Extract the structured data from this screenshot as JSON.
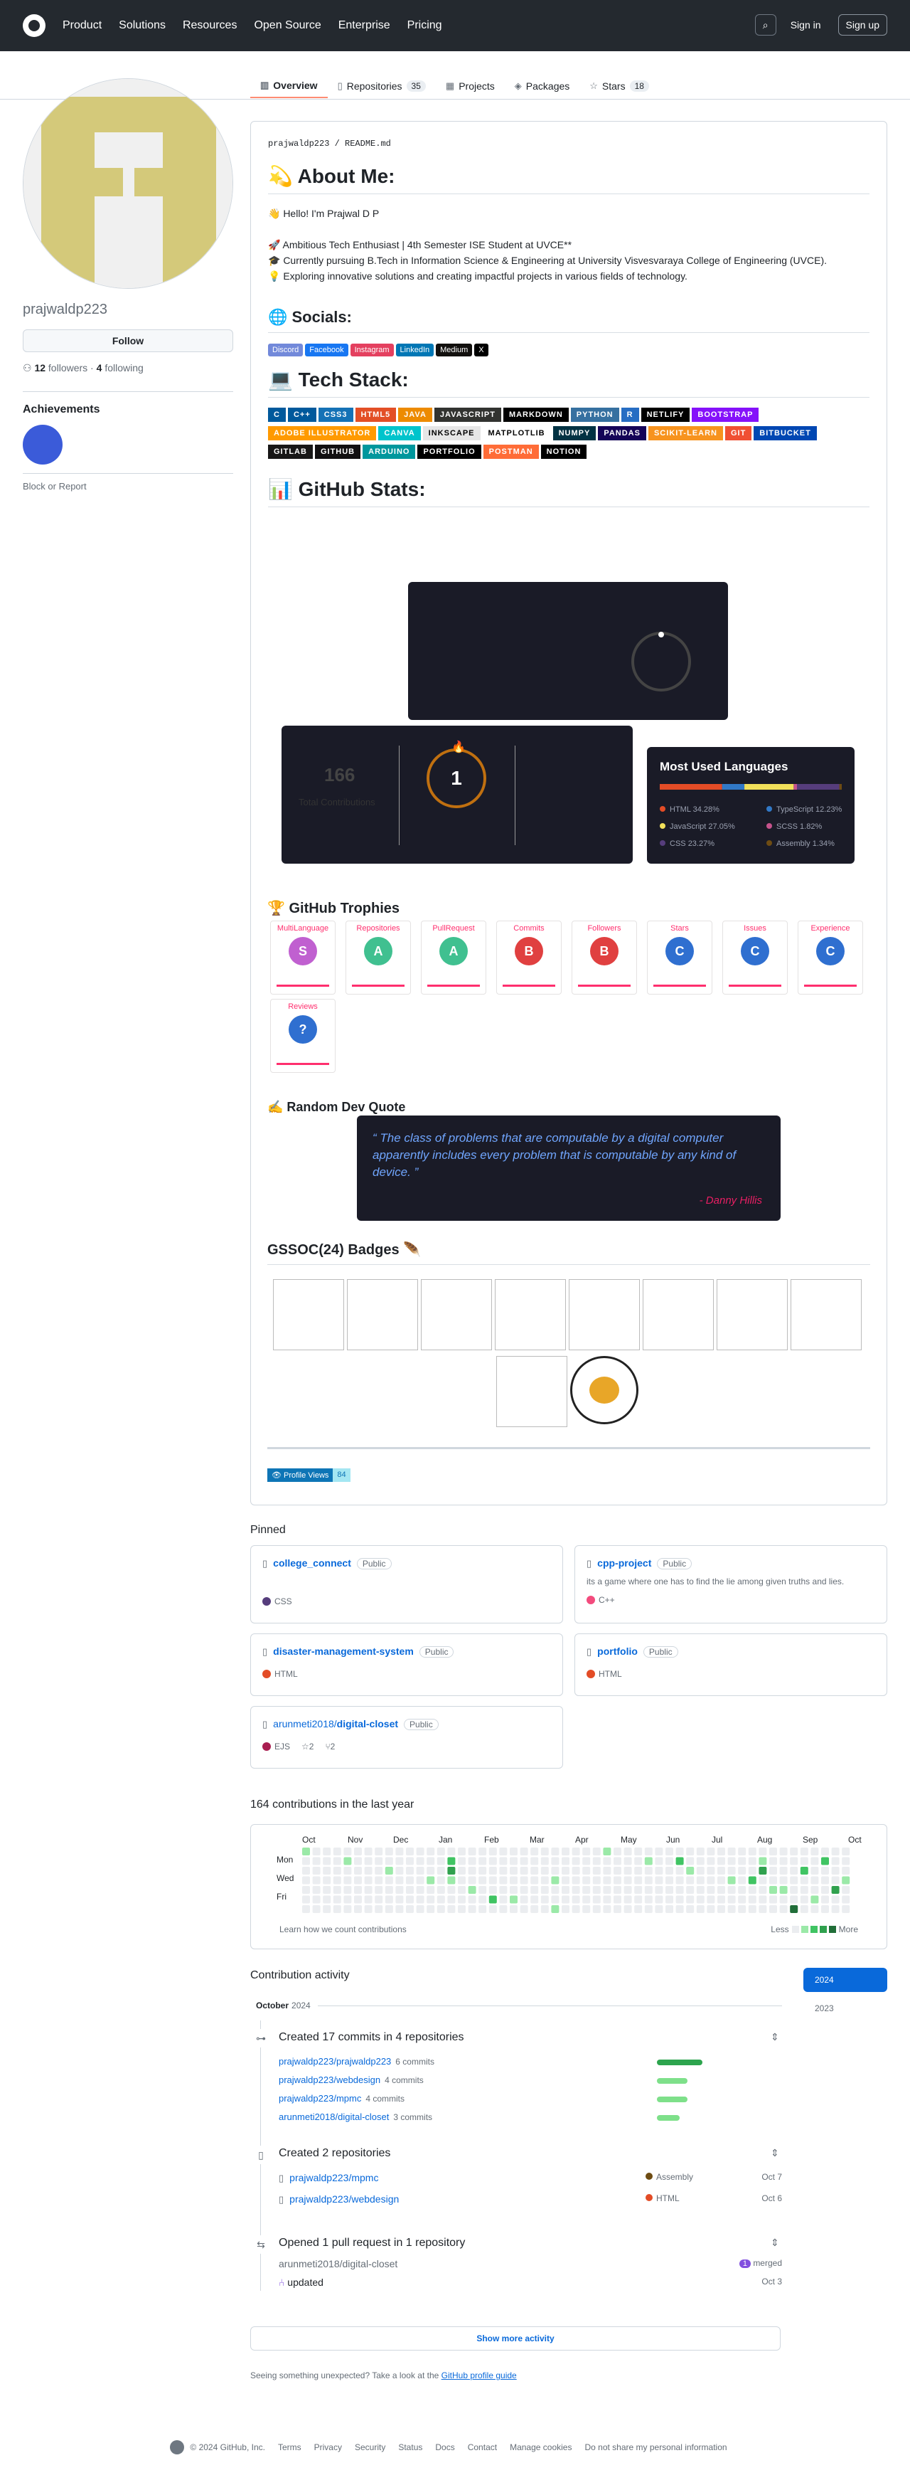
{
  "header": {
    "nav": [
      "Product",
      "Solutions",
      "Resources",
      "Open Source",
      "Enterprise",
      "Pricing"
    ],
    "sign_in": "Sign in",
    "sign_up": "Sign up"
  },
  "tabs": [
    {
      "label": "Overview"
    },
    {
      "label": "Repositories",
      "count": "35"
    },
    {
      "label": "Projects"
    },
    {
      "label": "Packages"
    },
    {
      "label": "Stars",
      "count": "18"
    }
  ],
  "profile": {
    "username": "prajwaldp223",
    "follow": "Follow",
    "followers": "12",
    "followers_label": "followers",
    "following": "4",
    "following_label": "following",
    "achievements_title": "Achievements",
    "report": "Block or Report"
  },
  "readme": {
    "path_user": "prajwaldp223",
    "path_file": "README.md",
    "about_title": "💫 About Me:",
    "about_lines": [
      "👋 Hello! I'm Prajwal D P",
      "🚀 Ambitious Tech Enthusiast | 4th Semester ISE Student at UVCE**",
      "🎓 Currently pursuing B.Tech in Information Science & Engineering at University Visvesvaraya College of Engineering (UVCE).",
      "💡 Exploring innovative solutions and creating impactful projects in various fields of technology."
    ],
    "socials_title": "🌐 Socials:",
    "socials": [
      {
        "label": "Discord",
        "color": "#7289da"
      },
      {
        "label": "Facebook",
        "color": "#1877f2"
      },
      {
        "label": "Instagram",
        "color": "#e4405f"
      },
      {
        "label": "LinkedIn",
        "color": "#0077b5"
      },
      {
        "label": "Medium",
        "color": "#12100e"
      },
      {
        "label": "X",
        "color": "#000000"
      }
    ],
    "tech_title": "💻 Tech Stack:",
    "tech": [
      {
        "label": "C",
        "color": "#00599c"
      },
      {
        "label": "C++",
        "color": "#00599c"
      },
      {
        "label": "CSS3",
        "color": "#1572b6"
      },
      {
        "label": "HTML5",
        "color": "#e34f26"
      },
      {
        "label": "JAVA",
        "color": "#ed8b00"
      },
      {
        "label": "JAVASCRIPT",
        "color": "#323330"
      },
      {
        "label": "MARKDOWN",
        "color": "#000000"
      },
      {
        "label": "PYTHON",
        "color": "#3670a0"
      },
      {
        "label": "R",
        "color": "#276dc3"
      },
      {
        "label": "NETLIFY",
        "color": "#000000"
      },
      {
        "label": "BOOTSTRAP",
        "color": "#8511fa"
      },
      {
        "label": "ADOBE ILLUSTRATOR",
        "color": "#ff9a00"
      },
      {
        "label": "CANVA",
        "color": "#00c4cc"
      },
      {
        "label": "INKSCAPE",
        "color": "#e6e6e6",
        "fg": "#000000"
      },
      {
        "label": "MATPLOTLIB",
        "color": "#ffffff",
        "fg": "#000000"
      },
      {
        "label": "NUMPY",
        "color": "#013243"
      },
      {
        "label": "PANDAS",
        "color": "#150458"
      },
      {
        "label": "SCIKIT-LEARN",
        "color": "#f7931e"
      },
      {
        "label": "GIT",
        "color": "#f05033"
      },
      {
        "label": "BITBUCKET",
        "color": "#0047b3"
      },
      {
        "label": "GITLAB",
        "color": "#181717"
      },
      {
        "label": "GITHUB",
        "color": "#121011"
      },
      {
        "label": "ARDUINO",
        "color": "#00979d"
      },
      {
        "label": "PORTFOLIO",
        "color": "#000000"
      },
      {
        "label": "POSTMAN",
        "color": "#ff6c37"
      },
      {
        "label": "NOTION",
        "color": "#000000"
      }
    ],
    "stats_title": "📊 GitHub Stats:",
    "streak": {
      "total": "166",
      "total_label": "Total Contributions",
      "current": "1"
    },
    "languages": {
      "title": "Most Used Languages",
      "items": [
        {
          "name": "HTML",
          "pct": "34.28%",
          "value": 34.28,
          "color": "#e34c26"
        },
        {
          "name": "TypeScript",
          "pct": "12.23%",
          "value": 12.23,
          "color": "#3178c6"
        },
        {
          "name": "JavaScript",
          "pct": "27.05%",
          "value": 27.05,
          "color": "#f1e05a"
        },
        {
          "name": "SCSS",
          "pct": "1.82%",
          "value": 1.82,
          "color": "#c6538c"
        },
        {
          "name": "CSS",
          "pct": "23.27%",
          "value": 23.27,
          "color": "#563d7c"
        },
        {
          "name": "Assembly",
          "pct": "1.34%",
          "value": 1.34,
          "color": "#6e4c13"
        }
      ]
    },
    "trophies_title": "🏆 GitHub Trophies",
    "trophies": [
      {
        "label": "MultiLanguage",
        "rank": "S",
        "color": "#c060d0"
      },
      {
        "label": "Repositories",
        "rank": "A",
        "color": "#40c090"
      },
      {
        "label": "PullRequest",
        "rank": "A",
        "color": "#40c090"
      },
      {
        "label": "Commits",
        "rank": "B",
        "color": "#e04040"
      },
      {
        "label": "Followers",
        "rank": "B",
        "color": "#e04040"
      },
      {
        "label": "Stars",
        "rank": "C",
        "color": "#2f6fd0"
      },
      {
        "label": "Issues",
        "rank": "C",
        "color": "#2f6fd0"
      },
      {
        "label": "Experience",
        "rank": "C",
        "color": "#2f6fd0"
      },
      {
        "label": "Reviews",
        "rank": "?",
        "color": "#2f6fd0"
      }
    ],
    "quote_title": "✍️ Random Dev Quote",
    "quote": {
      "text": "The class of problems that are computable by a digital computer apparently includes every problem that is computable by any kind of device.",
      "author": "- Danny Hillis"
    },
    "gssoc_title": "GSSOC(24) Badges 🪶",
    "views_label": "Profile Views",
    "views": "84"
  },
  "pinned": {
    "title": "Pinned",
    "items": [
      {
        "name": "college_connect",
        "vis": "Public",
        "desc": "",
        "lang": "CSS",
        "lang_color": "#563d7c"
      },
      {
        "name": "cpp-project",
        "vis": "Public",
        "desc": "its a game where one has to find the lie among given truths and lies.",
        "lang": "C++",
        "lang_color": "#f34b7d"
      },
      {
        "name": "disaster-management-system",
        "vis": "Public",
        "desc": "",
        "lang": "HTML",
        "lang_color": "#e34c26"
      },
      {
        "name": "portfolio",
        "vis": "Public",
        "desc": "",
        "lang": "HTML",
        "lang_color": "#e34c26"
      },
      {
        "owner": "arunmeti2018/",
        "name": "digital-closet",
        "vis": "Public",
        "desc": "",
        "lang": "EJS",
        "lang_color": "#a91e50",
        "stars": "2",
        "forks": "2"
      }
    ]
  },
  "contributions": {
    "title": "164 contributions in the last year",
    "months": [
      "Oct",
      "Nov",
      "Dec",
      "Jan",
      "Feb",
      "Mar",
      "Apr",
      "May",
      "Jun",
      "Jul",
      "Aug",
      "Sep",
      "Oct"
    ],
    "days": [
      "Mon",
      "Wed",
      "Fri"
    ],
    "learn": "Learn how we count contributions",
    "less": "Less",
    "more": "More"
  },
  "activity": {
    "title": "Contribution activity",
    "years": [
      "2024",
      "2023"
    ],
    "month": "October",
    "month_year": "2024",
    "commits": {
      "title": "Created 17 commits in 4 repositories",
      "rows": [
        {
          "repo": "prajwaldp223/prajwaldp223",
          "count": "6 commits",
          "value": 6
        },
        {
          "repo": "prajwaldp223/webdesign",
          "count": "4 commits",
          "value": 4
        },
        {
          "repo": "prajwaldp223/mpmc",
          "count": "4 commits",
          "value": 4
        },
        {
          "repo": "arunmeti2018/digital-closet",
          "count": "3 commits",
          "value": 3
        }
      ]
    },
    "repos": {
      "title": "Created 2 repositories",
      "rows": [
        {
          "repo": "prajwaldp223/mpmc",
          "lang": "Assembly",
          "color": "#6e4c13",
          "date": "Oct 7"
        },
        {
          "repo": "prajwaldp223/webdesign",
          "lang": "HTML",
          "color": "#e34c26",
          "date": "Oct 6"
        }
      ]
    },
    "pr": {
      "title": "Opened 1 pull request in 1 repository",
      "repo": "arunmeti2018/digital-closet",
      "count": "1",
      "state": "merged",
      "item": "updated",
      "date": "Oct 3"
    },
    "show_more": "Show more activity",
    "seeing": "Seeing something unexpected? Take a look at the",
    "guide": "GitHub profile guide"
  },
  "footer": [
    "© 2024 GitHub, Inc.",
    "Terms",
    "Privacy",
    "Security",
    "Status",
    "Docs",
    "Contact",
    "Manage cookies",
    "Do not share my personal information"
  ]
}
